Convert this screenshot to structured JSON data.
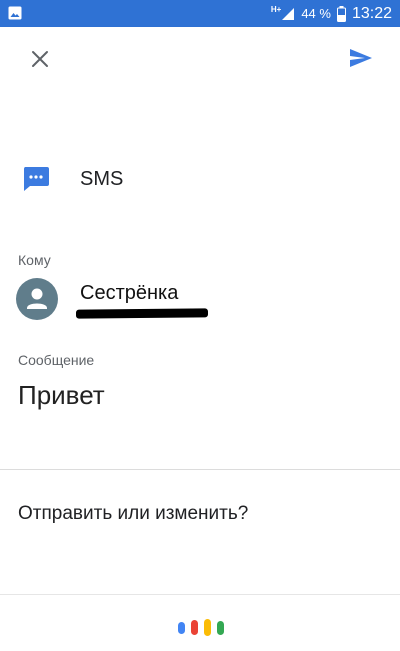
{
  "status_bar": {
    "network_label": "H+",
    "battery_percent": "44 %",
    "time": "13:22",
    "icons": [
      "gallery-icon",
      "signal-icon",
      "battery-icon"
    ],
    "background_color": "#2f72d4"
  },
  "header": {
    "close_icon": "close-icon",
    "send_icon": "send-icon",
    "accent_color": "#3c7be0"
  },
  "app": {
    "icon": "message-bubble-icon",
    "name": "SMS"
  },
  "recipient": {
    "label": "Кому",
    "name": "Сестрёнка",
    "avatar_icon": "person-icon"
  },
  "message": {
    "label": "Сообщение",
    "text": "Привет"
  },
  "footer": {
    "prompt": "Отправить или изменить?",
    "assistant_dot_colors": [
      "#4285f4",
      "#ea4335",
      "#fbbc05",
      "#34a853"
    ]
  }
}
